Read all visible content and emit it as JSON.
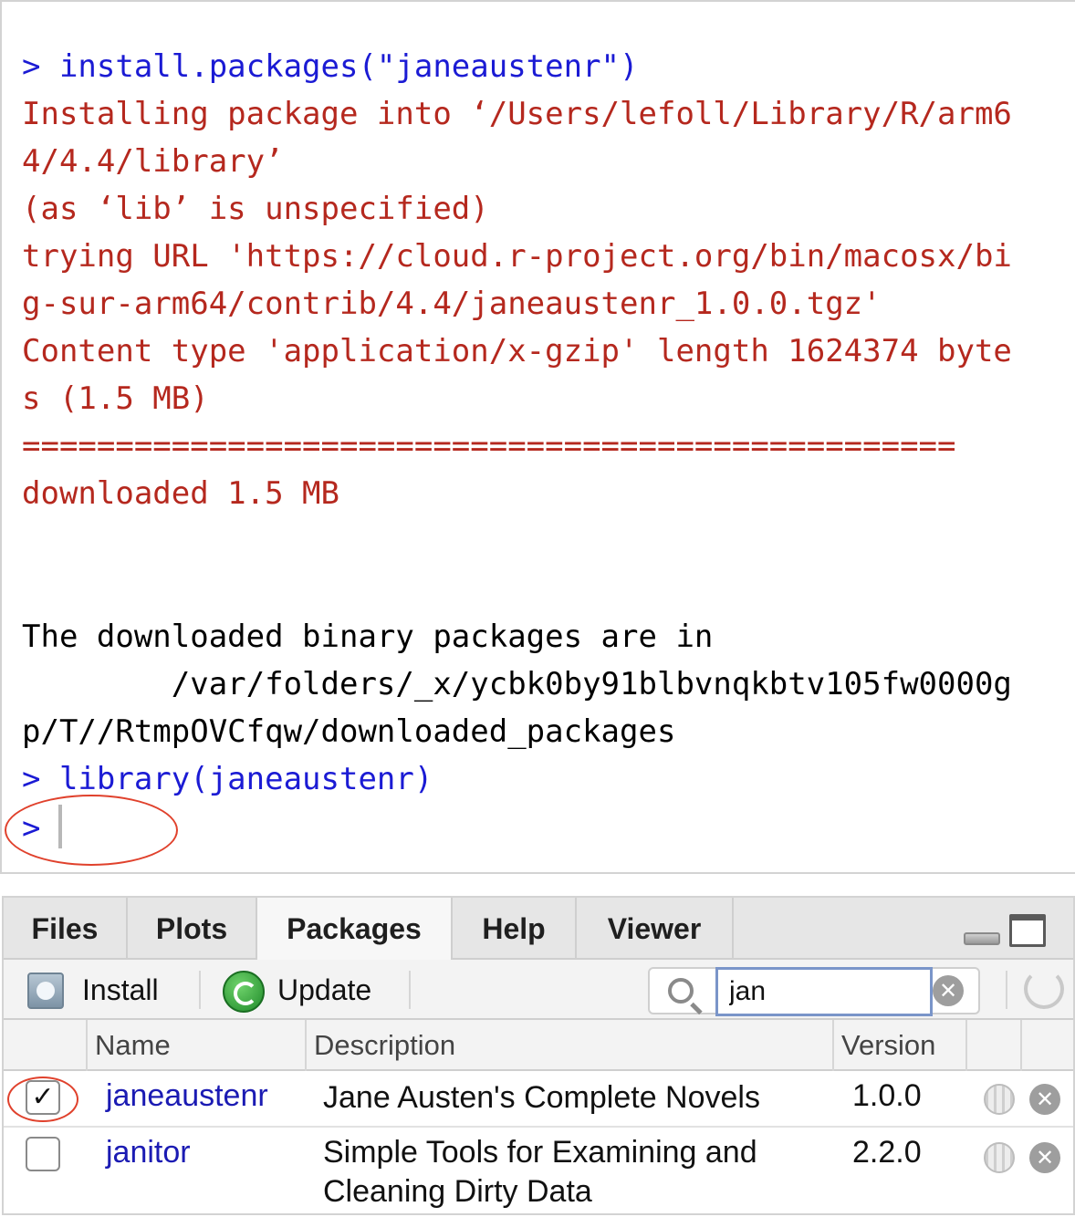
{
  "console": {
    "lines": [
      {
        "text": "> install.packages(\"janeaustenr\")",
        "color": "#1b1bd4"
      },
      {
        "text": "Installing package into ‘/Users/lefoll/Library/R/arm6",
        "color": "#b5281e"
      },
      {
        "text": "4/4.4/library’",
        "color": "#b5281e"
      },
      {
        "text": "(as ‘lib’ is unspecified)",
        "color": "#b5281e"
      },
      {
        "text": "trying URL 'https://cloud.r-project.org/bin/macosx/bi",
        "color": "#b5281e"
      },
      {
        "text": "g-sur-arm64/contrib/4.4/janeaustenr_1.0.0.tgz'",
        "color": "#b5281e"
      },
      {
        "text": "Content type 'application/x-gzip' length 1624374 byte",
        "color": "#b5281e"
      },
      {
        "text": "s (1.5 MB)",
        "color": "#b5281e"
      },
      {
        "text": "==================================================",
        "color": "#b5281e"
      },
      {
        "text": "downloaded 1.5 MB",
        "color": "#b5281e"
      },
      {
        "text": "The downloaded binary packages are in",
        "color": "#000000"
      },
      {
        "text": "        /var/folders/_x/ycbk0by91blbvnqkbtv105fw0000g",
        "color": "#000000"
      },
      {
        "text": "p/T//RtmpOVCfqw/downloaded_packages",
        "color": "#000000"
      },
      {
        "text": "> library(janeaustenr)",
        "color": "#1b1bd4"
      },
      {
        "text": ">",
        "color": "#1b1bd4"
      }
    ]
  },
  "tabs": [
    "Files",
    "Plots",
    "Packages",
    "Help",
    "Viewer"
  ],
  "active_tab": "Packages",
  "toolbar": {
    "install_label": "Install",
    "update_label": "Update",
    "search_value": "jan"
  },
  "table": {
    "headers": {
      "name": "Name",
      "description": "Description",
      "version": "Version"
    },
    "rows": [
      {
        "checked": true,
        "name": "janeaustenr",
        "description": "Jane Austen's Complete Novels",
        "version": "1.0.0"
      },
      {
        "checked": false,
        "name": "janitor",
        "description": "Simple Tools for Examining and Cleaning Dirty Data",
        "version": "2.2.0"
      }
    ]
  },
  "colors": {
    "prompt": "#1b1bd4",
    "message": "#b5281e",
    "annotation": "#e0412c",
    "link": "#1b1bb3"
  }
}
